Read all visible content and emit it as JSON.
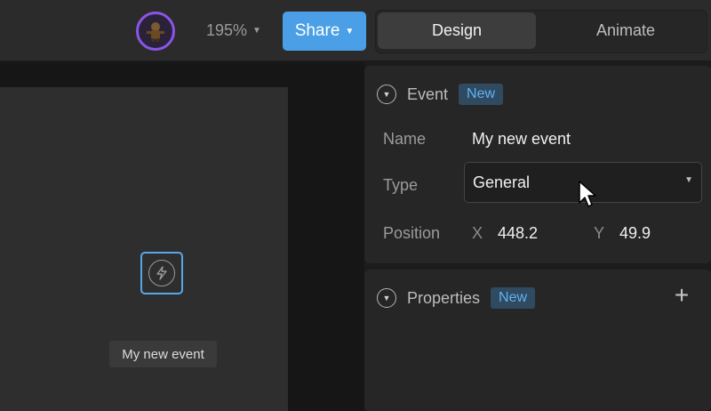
{
  "toolbar": {
    "zoom_label": "195%",
    "share_label": "Share",
    "tabs": [
      {
        "label": "Design",
        "active": true
      },
      {
        "label": "Animate",
        "active": false
      }
    ]
  },
  "canvas": {
    "event_node_label": "My new event"
  },
  "event_panel": {
    "title": "Event",
    "badge": "New",
    "name_label": "Name",
    "name_value": "My new event",
    "type_label": "Type",
    "type_value": "General",
    "position_label": "Position",
    "x_label": "X",
    "x_value": "448.2",
    "y_label": "Y",
    "y_value": "49.9"
  },
  "properties_panel": {
    "title": "Properties",
    "badge": "New"
  },
  "colors": {
    "accent": "#4a9fe6",
    "badge_bg": "#2f4a61",
    "badge_text": "#62b2f2",
    "avatar_ring": "#8a55e6"
  },
  "icons": [
    "user-avatar-icon",
    "chevron-down-icon",
    "lightning-icon",
    "collapse-icon",
    "plus-icon",
    "mouse-pointer-icon"
  ]
}
